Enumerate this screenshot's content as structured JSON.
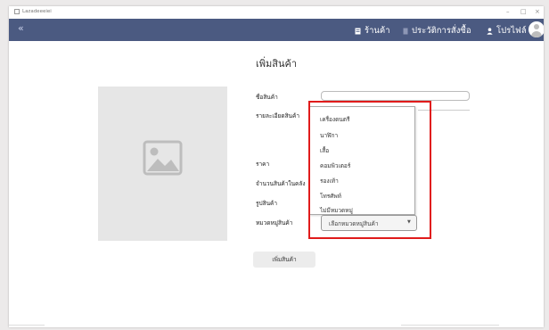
{
  "window": {
    "app_title": "Lazadeeeiei",
    "minimize": "–",
    "maximize": "□",
    "close": "×"
  },
  "navbar": {
    "back_icon": "«",
    "items": [
      {
        "label": "ร้านค้า",
        "icon": "store-icon"
      },
      {
        "label": "ประวัติการสั่งซื้อ",
        "icon": "receipt-icon"
      },
      {
        "label": "โปรไฟล์",
        "icon": "user-icon"
      }
    ],
    "accent": "#4b5a81"
  },
  "form": {
    "title": "เพิ่มสินค้า",
    "labels": {
      "name": "ชื่อสินค้า",
      "description": "รายละเอียดสินค้า",
      "price": "ราคา",
      "stock": "จำนวนสินค้าในคลัง",
      "image": "รูปสินค้า",
      "category": "หมวดหมู่สินค้า"
    },
    "category_select": {
      "value": "เลือกหมวดหมู่สินค้า",
      "options": [
        "เครื่องดนตรี",
        "นาฬิกา",
        "เสื้อ",
        "คอมพิวเตอร์",
        "รองเท้า",
        "โทรศัพท์",
        "ไม่มีหมวดหมู่"
      ]
    },
    "submit_label": "เพิ่มสินค้า"
  },
  "highlight_color": "#e01b1b"
}
